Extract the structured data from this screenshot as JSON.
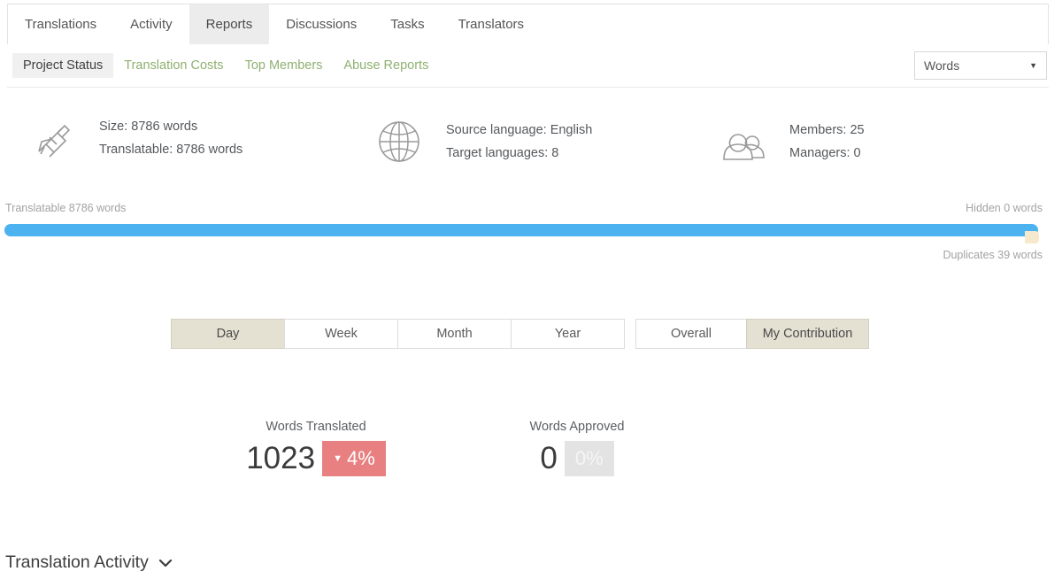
{
  "nav": {
    "tabs": [
      {
        "label": "Translations",
        "active": false
      },
      {
        "label": "Activity",
        "active": false
      },
      {
        "label": "Reports",
        "active": true
      },
      {
        "label": "Discussions",
        "active": false
      },
      {
        "label": "Tasks",
        "active": false
      },
      {
        "label": "Translators",
        "active": false
      }
    ]
  },
  "subnav": {
    "links": [
      {
        "label": "Project Status",
        "active": true
      },
      {
        "label": "Translation Costs",
        "active": false
      },
      {
        "label": "Top Members",
        "active": false
      },
      {
        "label": "Abuse Reports",
        "active": false
      }
    ],
    "unit_select": {
      "value": "Words",
      "caret_icon": "chevron-down-icon"
    }
  },
  "info": {
    "blocks": [
      {
        "icon": "caliper-icon",
        "line1": "Size: 8786 words",
        "line2": "Translatable: 8786 words"
      },
      {
        "icon": "globe-icon",
        "line1": "Source language: English",
        "line2": "Target languages: 8"
      },
      {
        "icon": "users-icon",
        "line1": "Members: 25",
        "line2": "Managers: 0"
      }
    ]
  },
  "progress": {
    "translatable_label": "Translatable 8786 words",
    "hidden_label": "Hidden 0 words",
    "duplicates_label": "Duplicates 39 words",
    "bar_color": "#4db3f0",
    "duplicates_color": "#f6e9cd"
  },
  "period": {
    "range_buttons": [
      {
        "label": "Day",
        "active": true
      },
      {
        "label": "Week",
        "active": false
      },
      {
        "label": "Month",
        "active": false
      },
      {
        "label": "Year",
        "active": false
      }
    ],
    "scope_buttons": [
      {
        "label": "Overall",
        "active": false
      },
      {
        "label": "My Contribution",
        "active": true
      }
    ],
    "active_color": "#e4e0d2"
  },
  "stats": [
    {
      "label": "Words Translated",
      "value": "1023",
      "badge": "4%",
      "badge_trend_icon": "triangle-down-icon",
      "badge_trend": "down",
      "badge_color": "#e87f80"
    },
    {
      "label": "Words Approved",
      "value": "0",
      "badge": "0%",
      "badge_trend_icon": "none",
      "badge_trend": "zero",
      "badge_color": "#e3e3e3"
    }
  ],
  "footer": {
    "activity_title": "Translation Activity",
    "chevron_icon": "chevron-down-icon"
  }
}
